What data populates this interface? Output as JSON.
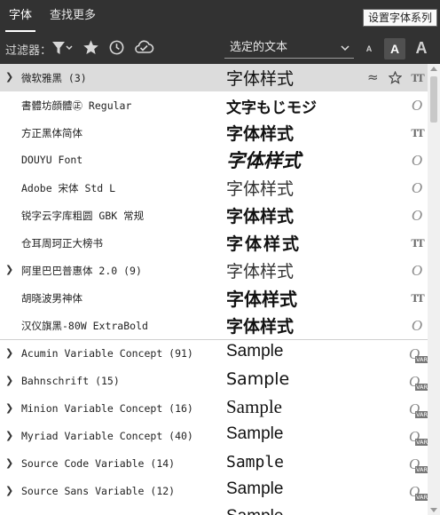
{
  "tabs": [
    {
      "label": "字体",
      "active": true
    },
    {
      "label": "查找更多",
      "active": false
    }
  ],
  "tooltip": "设置字体系列",
  "toolbar": {
    "filter_label": "过滤器：",
    "preview_select": "选定的文本",
    "size_small": "A",
    "size_medium": "A",
    "size_large": "A"
  },
  "fonts": [
    {
      "name": "微软雅黑 (3)",
      "sample": "字体样式",
      "expandable": true,
      "type": "truetype",
      "highlight": true
    },
    {
      "name": "書體坊顔體㊣ Regular",
      "sample": "文字もじモジ",
      "expandable": false,
      "type": "opentype"
    },
    {
      "name": "方正黑体简体",
      "sample": "字体样式",
      "expandable": false,
      "type": "truetype"
    },
    {
      "name": "DOUYU Font",
      "sample": "字体样式",
      "expandable": false,
      "type": "opentype"
    },
    {
      "name": "Adobe 宋体 Std L",
      "sample": "字体样式",
      "expandable": false,
      "type": "opentype"
    },
    {
      "name": "锐字云字库粗圆 GBK 常规",
      "sample": "字体样式",
      "expandable": false,
      "type": "opentype"
    },
    {
      "name": "仓耳周珂正大榜书",
      "sample": "字体样式",
      "expandable": false,
      "type": "truetype"
    },
    {
      "name": "阿里巴巴普惠体 2.0 (9)",
      "sample": "字体样式",
      "expandable": true,
      "type": "opentype"
    },
    {
      "name": "胡晓波男神体",
      "sample": "字体样式",
      "expandable": false,
      "type": "truetype"
    },
    {
      "name": "汉仪旗黑-80W ExtraBold",
      "sample": "字体样式",
      "expandable": false,
      "type": "opentype"
    },
    {
      "name": "Acumin Variable Concept (91)",
      "sample": "Sample",
      "expandable": true,
      "type": "variable"
    },
    {
      "name": "Bahnschrift (15)",
      "sample": "Sample",
      "expandable": true,
      "type": "variable"
    },
    {
      "name": "Minion Variable Concept (16)",
      "sample": "Sample",
      "expandable": true,
      "type": "variable"
    },
    {
      "name": "Myriad Variable Concept (40)",
      "sample": "Sample",
      "expandable": true,
      "type": "variable"
    },
    {
      "name": "Source Code Variable (14)",
      "sample": "Sample",
      "expandable": true,
      "type": "variable"
    },
    {
      "name": "Source Sans Variable (12)",
      "sample": "Sample",
      "expandable": true,
      "type": "variable"
    },
    {
      "name": "",
      "sample": "Sample",
      "expandable": false,
      "type": "variable"
    }
  ],
  "row_actions": {
    "similar_icon": "approx-icon",
    "favorite_icon": "star-icon"
  },
  "var_badge": "VAR",
  "colors": {
    "toolbar_bg": "#323232",
    "list_bg": "#ffffff",
    "highlight": "#dcdcdc"
  }
}
